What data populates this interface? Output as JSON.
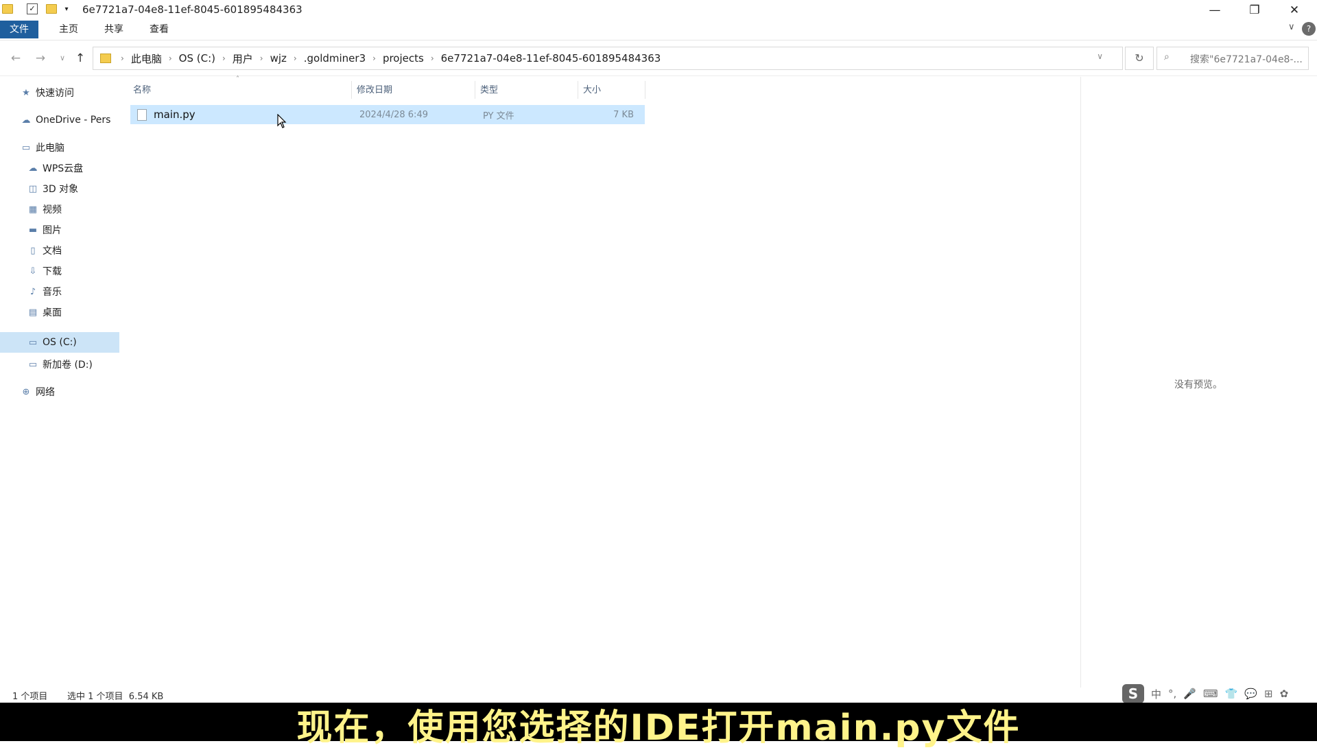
{
  "window": {
    "title": "6e7721a7-04e8-11ef-8045-601895484363",
    "minimize": "—",
    "restore": "❐",
    "close": "✕"
  },
  "ribbon": {
    "tabs": [
      "文件",
      "主页",
      "共享",
      "查看"
    ]
  },
  "address": {
    "back": "←",
    "forward": "→",
    "recent": "∨",
    "up": "↑",
    "crumbs": [
      "此电脑",
      "OS (C:)",
      "用户",
      "wjz",
      ".goldminer3",
      "projects",
      "6e7721a7-04e8-11ef-8045-601895484363"
    ],
    "search_placeholder": "搜索\"6e7721a7-04e8-..."
  },
  "sidebar": {
    "items": [
      {
        "label": "快速访问",
        "icon": "star-icon"
      },
      {
        "label": "OneDrive - Pers",
        "icon": "cloud-icon"
      },
      {
        "label": "此电脑",
        "icon": "computer-icon"
      },
      {
        "label": "WPS云盘",
        "icon": "cloud-icon"
      },
      {
        "label": "3D 对象",
        "icon": "cube-icon"
      },
      {
        "label": "视频",
        "icon": "video-icon"
      },
      {
        "label": "图片",
        "icon": "image-icon"
      },
      {
        "label": "文档",
        "icon": "document-icon"
      },
      {
        "label": "下载",
        "icon": "download-icon"
      },
      {
        "label": "音乐",
        "icon": "music-icon"
      },
      {
        "label": "桌面",
        "icon": "desktop-icon"
      },
      {
        "label": "OS (C:)",
        "icon": "drive-icon"
      },
      {
        "label": "新加卷 (D:)",
        "icon": "drive-icon"
      },
      {
        "label": "网络",
        "icon": "network-icon"
      }
    ]
  },
  "list": {
    "columns": [
      "名称",
      "修改日期",
      "类型",
      "大小"
    ],
    "rows": [
      {
        "name": "main.py",
        "date": "2024/4/28 6:49",
        "type": "PY 文件",
        "size": "7 KB"
      }
    ]
  },
  "preview": {
    "empty_text": "没有预览。"
  },
  "status": {
    "count": "1 个项目",
    "selection": "选中 1 个项目  6.54 KB"
  },
  "subtitle": "现在，使用您选择的IDE打开main.py文件",
  "tray": {
    "ime": "S",
    "items": [
      "中",
      "°,",
      "🎤",
      "⌨",
      "👕",
      "💬",
      "⊞",
      "✿"
    ]
  }
}
